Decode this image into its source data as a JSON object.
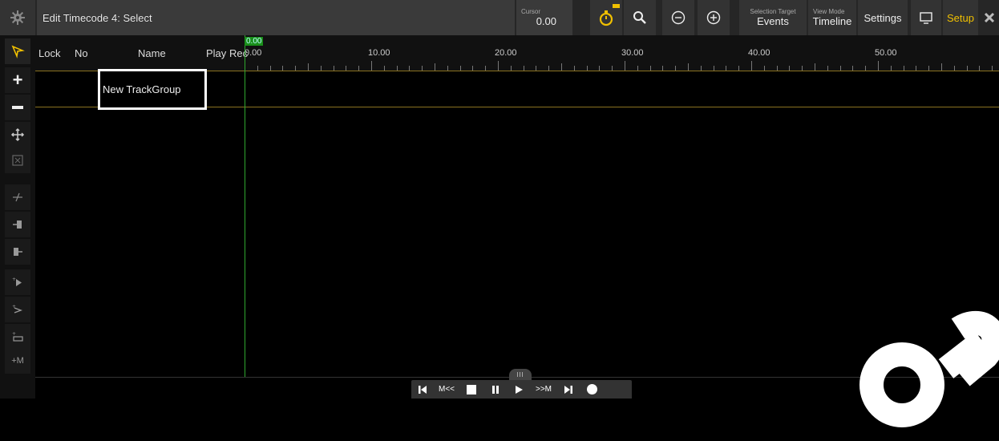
{
  "window": {
    "title": "Edit Timecode 4: Select"
  },
  "toolbar": {
    "cursor_label": "Cursor",
    "cursor_value": "0.00",
    "selection_target_label": "Selection Target",
    "selection_target_value": "Events",
    "view_mode_label": "View Mode",
    "view_mode_value": "Timeline",
    "settings_label": "Settings",
    "setup_label": "Setup"
  },
  "columns": {
    "lock": "Lock",
    "no": "No",
    "name": "Name",
    "play": "Play",
    "rec": "Rec"
  },
  "cursor_tag": "0.00",
  "ruler": {
    "labels": [
      "0.00",
      "10.00",
      "20.00",
      "30.00",
      "40.00",
      "50.00"
    ]
  },
  "tracks": [
    {
      "name": "New TrackGroup"
    }
  ],
  "left_tools": {
    "add_marker": "+M"
  },
  "transport": {
    "prev_marker": "M<<",
    "next_marker": ">>M"
  },
  "colors": {
    "accent": "#f0c000",
    "cursor": "#2ea82e",
    "track_border": "#8a7220"
  }
}
